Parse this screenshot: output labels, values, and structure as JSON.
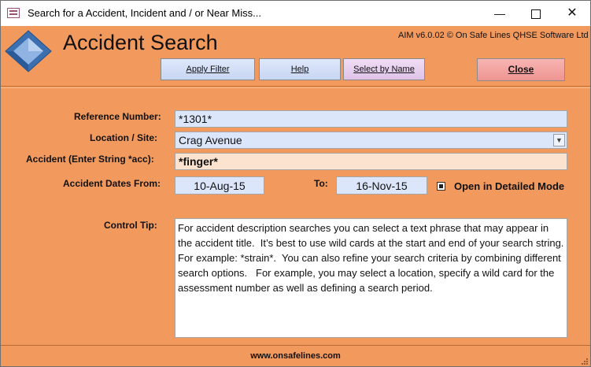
{
  "window": {
    "title": "Search for a Accident, Incident and / or Near Miss...",
    "icon": "form-icon",
    "controls": {
      "minimize": "—",
      "close": "✕"
    }
  },
  "header": {
    "title": "Accident Search",
    "version": "AIM v6.0.02 © On Safe Lines QHSE Software Ltd",
    "logo_colors": {
      "outer": "#3b6fb0",
      "inner": "#8fb4e3"
    }
  },
  "toolbar": {
    "apply_filter": "Apply Filter",
    "help": "Help",
    "select_by_name": "Select by Name",
    "close": "Close"
  },
  "form": {
    "reference": {
      "label": "Reference Number:",
      "value": "*1301*"
    },
    "location": {
      "label": "Location / Site:",
      "value": "Crag Avenue"
    },
    "accident": {
      "label": "Accident (Enter String *acc):",
      "value": "*finger*"
    },
    "dates": {
      "from_label": "Accident Dates From:",
      "from_value": "10-Aug-15",
      "to_label": "To:",
      "to_value": "16-Nov-15"
    },
    "detailed_mode": {
      "label": "Open in Detailed Mode",
      "checked": true
    }
  },
  "control_tip": {
    "label": "Control Tip:",
    "text": "For accident description searches you can select a text phrase that may appear in the accident title.  It’s best to use wild cards at the start and end of your search string. For example: *strain*.  You can also refine your search criteria by combining different search options.   For example, you may select a location, specify a wild card for the assessment number as well as defining a search period."
  },
  "footer": {
    "url": "www.onsafelines.com"
  },
  "colors": {
    "background": "#f2995e",
    "field_blue": "#dbe6fb",
    "field_peach": "#fbe3cf",
    "button_blue": "#c7d6f3",
    "button_lilac": "#dfc3e8",
    "button_close": "#ee9592"
  }
}
